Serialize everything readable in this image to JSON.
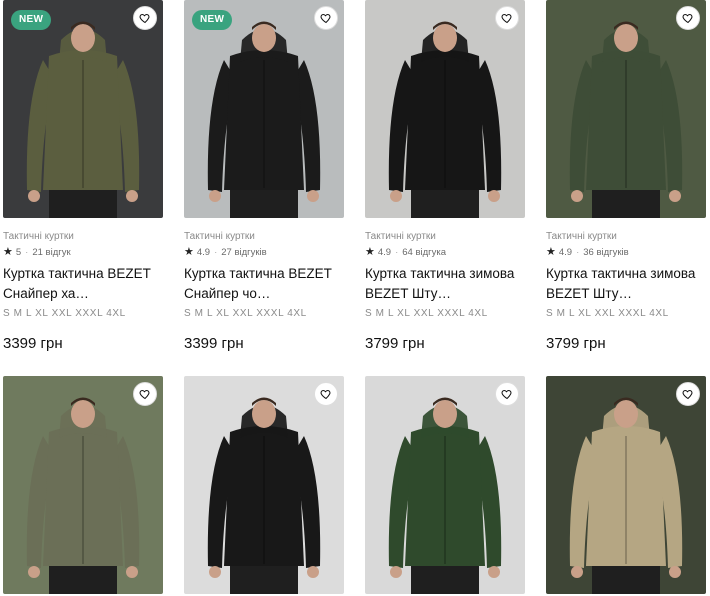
{
  "badges": {
    "new": "NEW"
  },
  "colors": {
    "new_badge": "#3aa37f"
  },
  "products": [
    {
      "category": "Тактичні куртки",
      "rating": "5",
      "reviews": "21 відгук",
      "title": "Куртка тактична BEZET Снайпер ха…",
      "sizes": "S M L XL XXL XXXL 4XL",
      "price": "3399 грн",
      "is_new": true,
      "jacket_color": "#5b5e3f",
      "bg_color": "#3a3b3d"
    },
    {
      "category": "Тактичні куртки",
      "rating": "4.9",
      "reviews": "27 відгуків",
      "title": "Куртка тактична BEZET Снайпер чо…",
      "sizes": "S M L XL XXL XXXL 4XL",
      "price": "3399 грн",
      "is_new": true,
      "jacket_color": "#1b1b1b",
      "bg_color": "#b9bcbd"
    },
    {
      "category": "Тактичні куртки",
      "rating": "4.9",
      "reviews": "64 відгука",
      "title": "Куртка тактична зимова BEZET Шту…",
      "sizes": "S M L XL XXL XXXL 4XL",
      "price": "3799 грн",
      "is_new": false,
      "jacket_color": "#161616",
      "bg_color": "#c8c8c6"
    },
    {
      "category": "Тактичні куртки",
      "rating": "4.9",
      "reviews": "36 відгуків",
      "title": "Куртка тактична зимова BEZET Шту…",
      "sizes": "S M L XL XXL XXXL 4XL",
      "price": "3799 грн",
      "is_new": false,
      "jacket_color": "#3e4d37",
      "bg_color": "#4f5a43"
    },
    {
      "jacket_color": "#6b6f57",
      "bg_color": "#6f7a5e"
    },
    {
      "jacket_color": "#181818",
      "bg_color": "#dcdcdc"
    },
    {
      "jacket_color": "#2f4a2c",
      "bg_color": "#d9d9d9"
    },
    {
      "jacket_color": "#b5a683",
      "bg_color": "#3e4536"
    }
  ]
}
